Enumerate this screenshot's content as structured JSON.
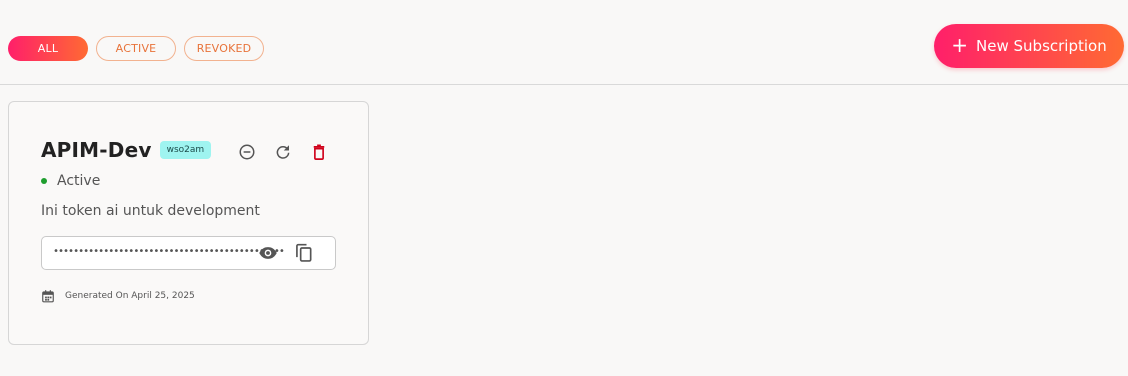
{
  "filters": [
    {
      "label": "ALL",
      "selected": true
    },
    {
      "label": "ACTIVE",
      "selected": false
    },
    {
      "label": "REVOKED",
      "selected": false
    }
  ],
  "new_button": {
    "icon": "plus-icon",
    "label": "New Subscription"
  },
  "colors": {
    "accent_start": "#ff1f6a",
    "accent_end": "#ff6a33",
    "badge_bg": "#9ff4f0",
    "status_active": "#1e9e2e",
    "delete_red": "#d0021b"
  },
  "card": {
    "title": "APIM-Dev",
    "badge": "wso2am",
    "status": "Active",
    "description": "Ini token ai untuk development",
    "token_masked": "••••••••••••••••••••••••••••••••••••••••••••••",
    "generated": "Generated On April 25, 2025",
    "actions": [
      "revoke-icon",
      "refresh-icon",
      "delete-icon"
    ],
    "token_actions": [
      "eye-icon",
      "copy-icon"
    ]
  }
}
